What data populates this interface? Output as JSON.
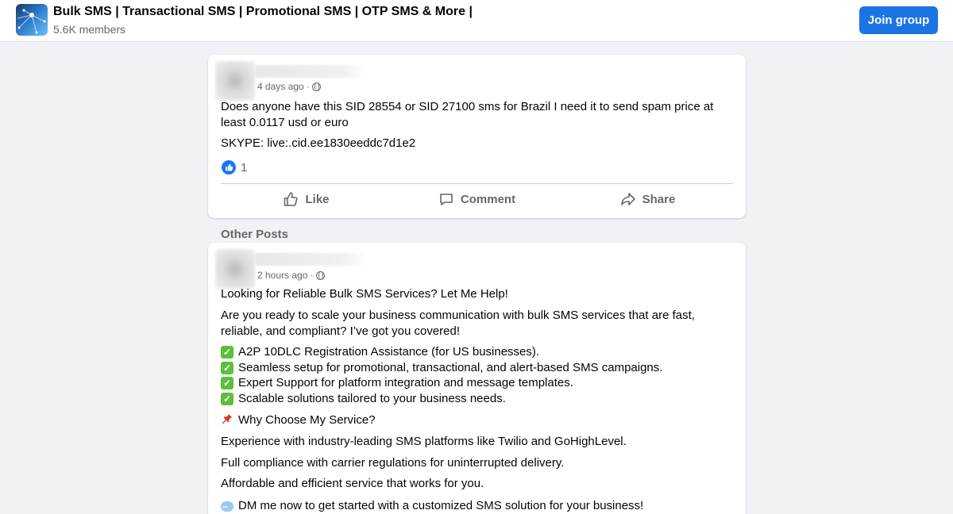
{
  "header": {
    "group_name": "Bulk SMS | Transactional SMS | Promotional SMS | OTP SMS & More |",
    "members": "5.6K members",
    "join_label": "Join group"
  },
  "post1": {
    "time": "4 days ago ·",
    "text": "Does anyone have this SID 28554 or SID 27100 sms for Brazil I need it to send spam price at least 0.0117 usd or euro",
    "skype": "SKYPE: live:.cid.ee1830eeddc7d1e2",
    "reaction_count": "1",
    "actions": {
      "like": "Like",
      "comment": "Comment",
      "share": "Share"
    }
  },
  "other_posts_label": "Other Posts",
  "post2": {
    "time": "2 hours ago ·",
    "headline": "Looking for Reliable Bulk SMS Services? Let Me Help!",
    "intro": "Are you ready to scale your business communication with bulk SMS services that are fast, reliable, and compliant? I’ve got you covered!",
    "bullets": [
      "A2P 10DLC Registration Assistance (for US businesses).",
      "Seamless setup for promotional, transactional, and alert-based SMS campaigns.",
      "Expert Support for platform integration and message templates.",
      "Scalable solutions tailored to your business needs."
    ],
    "why": "Why Choose My Service?",
    "p1": "Experience with industry-leading SMS platforms like Twilio and GoHighLevel.",
    "p2": "Full compliance with carrier regulations for uninterrupted delivery.",
    "p3": "Affordable and efficient service that works for you.",
    "dm": "DM me now to get started with a customized SMS solution for your business!"
  },
  "icons": {
    "check": "check-mark-icon",
    "pin": "pushpin-icon",
    "bubble": "speech-bubble-icon",
    "globe": "globe-icon"
  },
  "colors": {
    "accent": "#1b74e4",
    "background": "#f0f2f5",
    "secondary_text": "#65676b"
  }
}
